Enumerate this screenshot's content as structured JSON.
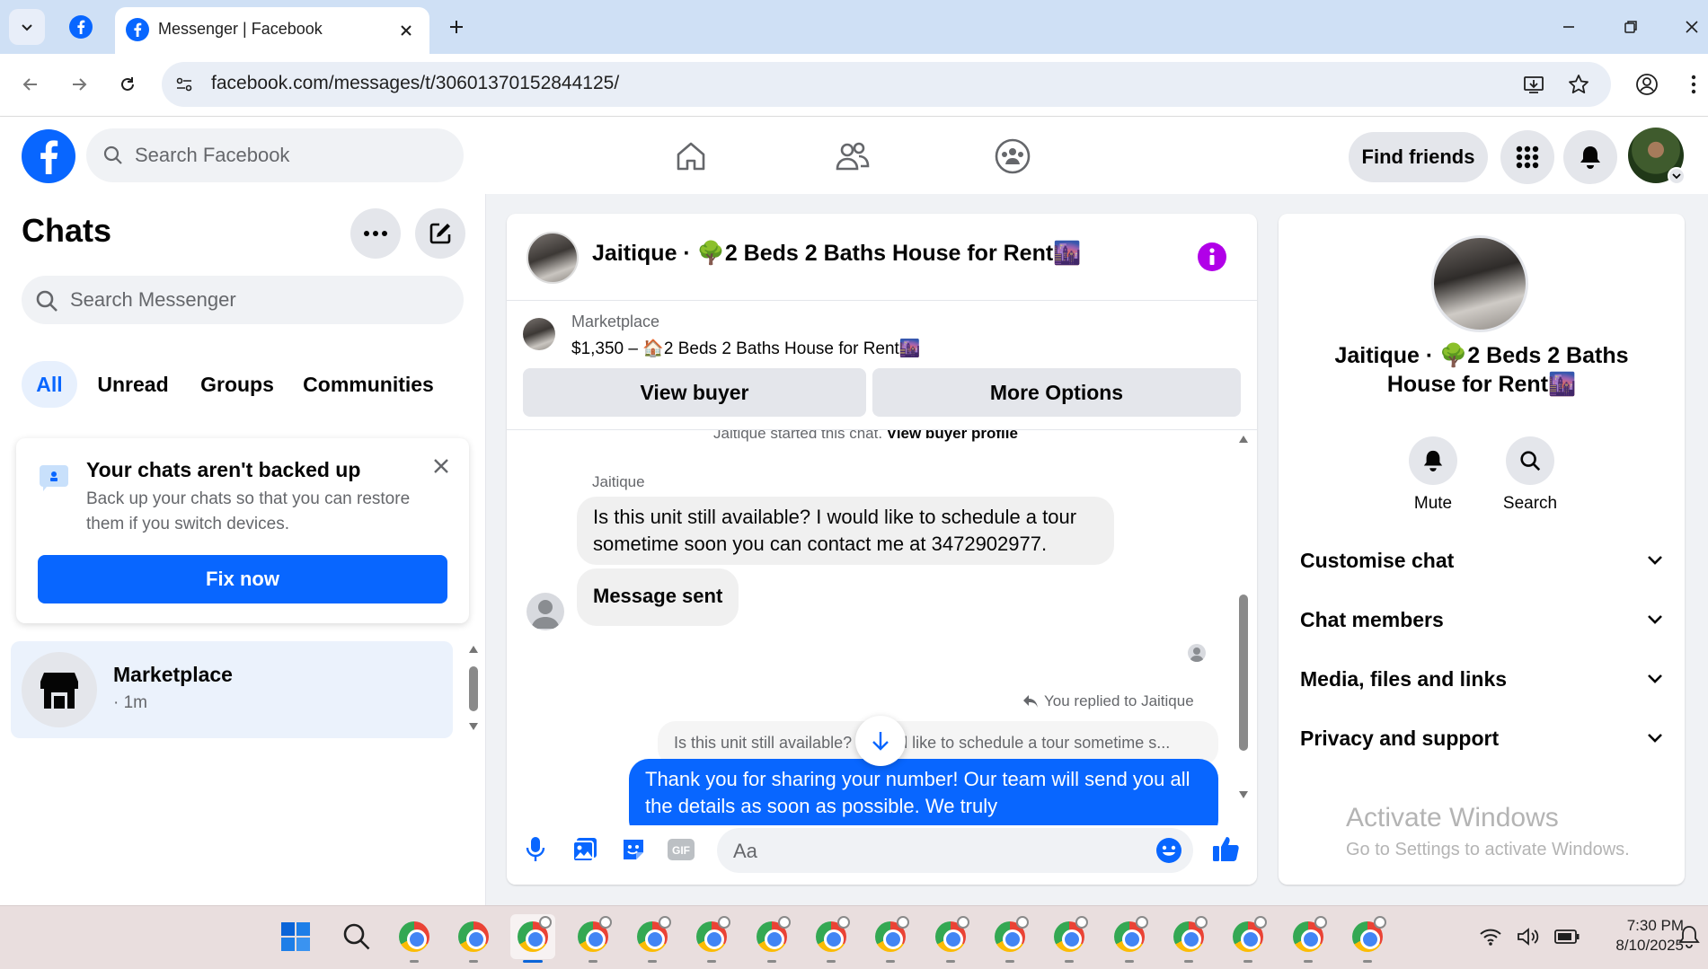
{
  "browser": {
    "tab_title": "Messenger | Facebook",
    "url": "facebook.com/messages/t/30601370152844125/"
  },
  "fb_header": {
    "search_placeholder": "Search Facebook",
    "find_friends": "Find friends"
  },
  "chats_panel": {
    "title": "Chats",
    "search_placeholder": "Search Messenger",
    "filters": [
      "All",
      "Unread",
      "Groups",
      "Communities"
    ],
    "backup_card": {
      "title": "Your chats aren't backed up",
      "body": "Back up your chats so that you can restore them if you switch devices.",
      "button": "Fix now"
    },
    "chat_items": [
      {
        "name": "Marketplace",
        "time": "· 1m"
      }
    ]
  },
  "conversation": {
    "title": "Jaitique · 🌳2 Beds 2 Baths House for Rent🌆",
    "listing": {
      "label": "Marketplace",
      "price_title": "$1,350 – 🏠2 Beds 2 Baths House for Rent🌆"
    },
    "buttons": {
      "view_buyer": "View buyer",
      "more_options": "More Options"
    },
    "started_text": "Jaitique started this chat.",
    "view_buyer_profile": "View buyer profile",
    "sender": "Jaitique",
    "messages": [
      "Is this unit still available? I would like to schedule a tour sometime soon you can contact me at 3472902977.",
      "Message sent"
    ],
    "replied_label": "You replied to Jaitique",
    "quoted": "Is this unit still available? I would like to schedule a tour sometime s...",
    "my_message": "Thank you for sharing your number!  Our team will send you all the details as soon as possible. We truly",
    "composer_placeholder": "Aa"
  },
  "details_panel": {
    "name": "Jaitique · 🌳2 Beds 2 Baths House for Rent🌆",
    "actions": [
      "Mute",
      "Search"
    ],
    "sections": [
      "Customise chat",
      "Chat members",
      "Media, files and links",
      "Privacy and support"
    ],
    "watermark_title": "Activate Windows",
    "watermark_sub": "Go to Settings to activate Windows."
  },
  "taskbar": {
    "time": "7:30 PM",
    "date": "8/10/2025"
  },
  "colors": {
    "fb_blue": "#0866ff",
    "messenger_purple": "#a033ff",
    "info_purple": "#b100e8"
  }
}
